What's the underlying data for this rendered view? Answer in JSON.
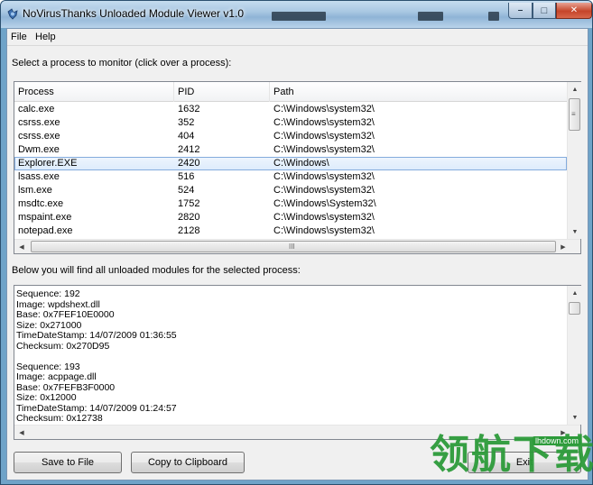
{
  "window": {
    "title": "NoVirusThanks Unloaded Module Viewer v1.0",
    "minimize_glyph": "–",
    "maximize_glyph": "□",
    "close_glyph": "✕"
  },
  "menu": {
    "file": "File",
    "help": "Help"
  },
  "process_section": {
    "label": "Select a process to monitor (click over a process):",
    "columns": {
      "process": "Process",
      "pid": "PID",
      "path": "Path"
    },
    "rows": [
      {
        "process": "calc.exe",
        "pid": "1632",
        "path": "C:\\Windows\\system32\\"
      },
      {
        "process": "csrss.exe",
        "pid": "352",
        "path": "C:\\Windows\\system32\\"
      },
      {
        "process": "csrss.exe",
        "pid": "404",
        "path": "C:\\Windows\\system32\\"
      },
      {
        "process": "Dwm.exe",
        "pid": "2412",
        "path": "C:\\Windows\\system32\\"
      },
      {
        "process": "Explorer.EXE",
        "pid": "2420",
        "path": "C:\\Windows\\"
      },
      {
        "process": "lsass.exe",
        "pid": "516",
        "path": "C:\\Windows\\system32\\"
      },
      {
        "process": "lsm.exe",
        "pid": "524",
        "path": "C:\\Windows\\system32\\"
      },
      {
        "process": "msdtc.exe",
        "pid": "1752",
        "path": "C:\\Windows\\System32\\"
      },
      {
        "process": "mspaint.exe",
        "pid": "2820",
        "path": "C:\\Windows\\system32\\"
      },
      {
        "process": "notepad.exe",
        "pid": "2128",
        "path": "C:\\Windows\\system32\\"
      }
    ],
    "selected_index": 4,
    "hscroll_grip": "III",
    "vscroll_grip": "≡"
  },
  "modules_section": {
    "label": "Below you will find all unloaded modules for the selected process:",
    "lines": [
      "Sequence: 192",
      "Image: wpdshext.dll",
      "Base: 0x7FEF10E0000",
      "Size: 0x271000",
      "TimeDateStamp: 14/07/2009 01:36:55",
      "Checksum: 0x270D95",
      "",
      "Sequence: 193",
      "Image: acppage.dll",
      "Base: 0x7FEFB3F0000",
      "Size: 0x12000",
      "TimeDateStamp: 14/07/2009 01:24:57",
      "Checksum: 0x12738"
    ]
  },
  "buttons": {
    "save": "Save to File",
    "copy": "Copy to Clipboard",
    "exit": "Exit"
  },
  "watermark": {
    "text": "领航下载",
    "site": "lhdown.com"
  },
  "colors": {
    "selection": "#dcebfc",
    "watermark": "#2d9b3a",
    "close": "#c5452a"
  }
}
